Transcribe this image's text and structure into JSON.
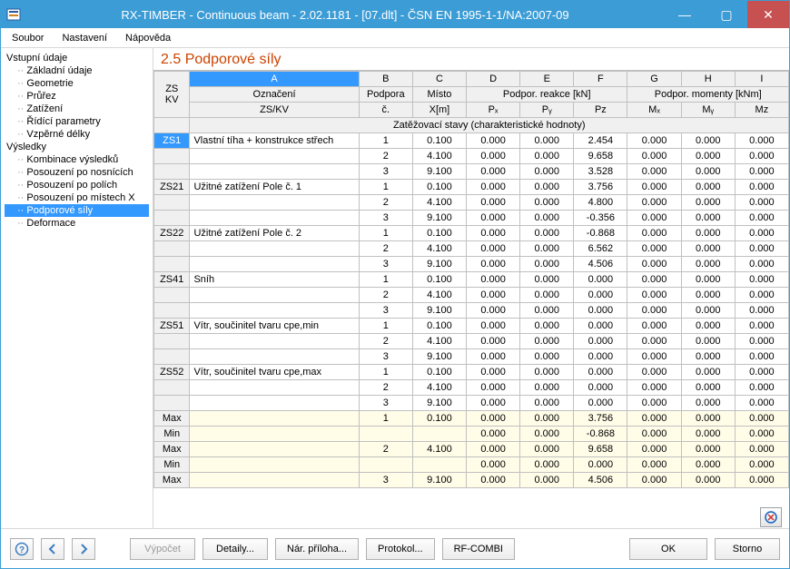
{
  "titlebar": {
    "title": "RX-TIMBER - Continuous beam - 2.02.1181 - [07.dlt] - ČSN EN 1995-1-1/NA:2007-09"
  },
  "menu": {
    "soubor": "Soubor",
    "nastaveni": "Nastavení",
    "napoveda": "Nápověda"
  },
  "nav": {
    "vstupni": "Vstupní údaje",
    "zakladni": "Základní údaje",
    "geometrie": "Geometrie",
    "prurez": "Průřez",
    "zatizeni": "Zatížení",
    "ridici": "Řídící parametry",
    "vzperne": "Vzpěrné délky",
    "vysledky": "Výsledky",
    "kombinace": "Kombinace výsledků",
    "nosniky": "Posouzení po nosnících",
    "polich": "Posouzení po polích",
    "mistech": "Posouzení po místech X",
    "podporove": "Podporové síly",
    "deformace": "Deformace"
  },
  "main": {
    "title": "2.5 Podporové síly"
  },
  "header": {
    "cols": {
      "A": "A",
      "B": "B",
      "C": "C",
      "D": "D",
      "E": "E",
      "F": "F",
      "G": "G",
      "H": "H",
      "I": "I"
    },
    "zs": "ZS",
    "kv": "KV",
    "oznaceni": "Označení",
    "zskv": "ZS/KV",
    "podpora": "Podpora",
    "c": "č.",
    "misto": "Místo",
    "xm": "X[m]",
    "reakce": "Podpor. reakce [kN]",
    "px": "Pₓ",
    "py": "Pᵧ",
    "pz": "Pz",
    "momenty": "Podpor. momenty [kNm]",
    "mx": "Mₓ",
    "my": "Mᵧ",
    "mz": "Mz"
  },
  "group1": "Zatěžovací stavy (charakteristické hodnoty)",
  "rows": [
    {
      "zs": "ZS1",
      "zs_sel": true,
      "label": "Vlastní tíha + konstrukce střech",
      "b": "1",
      "c": "0.100",
      "d": "0.000",
      "e": "0.000",
      "f": "2.454",
      "g": "0.000",
      "h": "0.000",
      "i": "0.000"
    },
    {
      "zs": "",
      "label": "",
      "b": "2",
      "c": "4.100",
      "d": "0.000",
      "e": "0.000",
      "f": "9.658",
      "g": "0.000",
      "h": "0.000",
      "i": "0.000"
    },
    {
      "zs": "",
      "label": "",
      "b": "3",
      "c": "9.100",
      "d": "0.000",
      "e": "0.000",
      "f": "3.528",
      "g": "0.000",
      "h": "0.000",
      "i": "0.000"
    },
    {
      "zs": "ZS21",
      "label": "Užitné zatížení Pole č. 1",
      "b": "1",
      "c": "0.100",
      "d": "0.000",
      "e": "0.000",
      "f": "3.756",
      "g": "0.000",
      "h": "0.000",
      "i": "0.000"
    },
    {
      "zs": "",
      "label": "",
      "b": "2",
      "c": "4.100",
      "d": "0.000",
      "e": "0.000",
      "f": "4.800",
      "g": "0.000",
      "h": "0.000",
      "i": "0.000"
    },
    {
      "zs": "",
      "label": "",
      "b": "3",
      "c": "9.100",
      "d": "0.000",
      "e": "0.000",
      "f": "-0.356",
      "g": "0.000",
      "h": "0.000",
      "i": "0.000"
    },
    {
      "zs": "ZS22",
      "label": "Užitné zatížení Pole č. 2",
      "b": "1",
      "c": "0.100",
      "d": "0.000",
      "e": "0.000",
      "f": "-0.868",
      "g": "0.000",
      "h": "0.000",
      "i": "0.000"
    },
    {
      "zs": "",
      "label": "",
      "b": "2",
      "c": "4.100",
      "d": "0.000",
      "e": "0.000",
      "f": "6.562",
      "g": "0.000",
      "h": "0.000",
      "i": "0.000"
    },
    {
      "zs": "",
      "label": "",
      "b": "3",
      "c": "9.100",
      "d": "0.000",
      "e": "0.000",
      "f": "4.506",
      "g": "0.000",
      "h": "0.000",
      "i": "0.000"
    },
    {
      "zs": "ZS41",
      "label": "Sníh",
      "b": "1",
      "c": "0.100",
      "d": "0.000",
      "e": "0.000",
      "f": "0.000",
      "g": "0.000",
      "h": "0.000",
      "i": "0.000"
    },
    {
      "zs": "",
      "label": "",
      "b": "2",
      "c": "4.100",
      "d": "0.000",
      "e": "0.000",
      "f": "0.000",
      "g": "0.000",
      "h": "0.000",
      "i": "0.000"
    },
    {
      "zs": "",
      "label": "",
      "b": "3",
      "c": "9.100",
      "d": "0.000",
      "e": "0.000",
      "f": "0.000",
      "g": "0.000",
      "h": "0.000",
      "i": "0.000"
    },
    {
      "zs": "ZS51",
      "label": "Vítr, součinitel tvaru cpe,min",
      "b": "1",
      "c": "0.100",
      "d": "0.000",
      "e": "0.000",
      "f": "0.000",
      "g": "0.000",
      "h": "0.000",
      "i": "0.000"
    },
    {
      "zs": "",
      "label": "",
      "b": "2",
      "c": "4.100",
      "d": "0.000",
      "e": "0.000",
      "f": "0.000",
      "g": "0.000",
      "h": "0.000",
      "i": "0.000"
    },
    {
      "zs": "",
      "label": "",
      "b": "3",
      "c": "9.100",
      "d": "0.000",
      "e": "0.000",
      "f": "0.000",
      "g": "0.000",
      "h": "0.000",
      "i": "0.000"
    },
    {
      "zs": "ZS52",
      "label": "Vítr, součinitel tvaru cpe,max",
      "b": "1",
      "c": "0.100",
      "d": "0.000",
      "e": "0.000",
      "f": "0.000",
      "g": "0.000",
      "h": "0.000",
      "i": "0.000"
    },
    {
      "zs": "",
      "label": "",
      "b": "2",
      "c": "4.100",
      "d": "0.000",
      "e": "0.000",
      "f": "0.000",
      "g": "0.000",
      "h": "0.000",
      "i": "0.000"
    },
    {
      "zs": "",
      "label": "",
      "b": "3",
      "c": "9.100",
      "d": "0.000",
      "e": "0.000",
      "f": "0.000",
      "g": "0.000",
      "h": "0.000",
      "i": "0.000"
    },
    {
      "zs": "Max",
      "cream": true,
      "label": "",
      "b": "1",
      "c": "0.100",
      "d": "0.000",
      "e": "0.000",
      "f": "3.756",
      "g": "0.000",
      "h": "0.000",
      "i": "0.000"
    },
    {
      "zs": "Min",
      "cream": true,
      "label": "",
      "b": "",
      "c": "",
      "d": "0.000",
      "e": "0.000",
      "f": "-0.868",
      "g": "0.000",
      "h": "0.000",
      "i": "0.000"
    },
    {
      "zs": "Max",
      "cream": true,
      "label": "",
      "b": "2",
      "c": "4.100",
      "d": "0.000",
      "e": "0.000",
      "f": "9.658",
      "g": "0.000",
      "h": "0.000",
      "i": "0.000"
    },
    {
      "zs": "Min",
      "cream": true,
      "label": "",
      "b": "",
      "c": "",
      "d": "0.000",
      "e": "0.000",
      "f": "0.000",
      "g": "0.000",
      "h": "0.000",
      "i": "0.000"
    },
    {
      "zs": "Max",
      "cream": true,
      "label": "",
      "b": "3",
      "c": "9.100",
      "d": "0.000",
      "e": "0.000",
      "f": "4.506",
      "g": "0.000",
      "h": "0.000",
      "i": "0.000"
    }
  ],
  "buttons": {
    "vypocet": "Výpočet",
    "detaily": "Detaily...",
    "priloha": "Nár. příloha...",
    "protokol": "Protokol...",
    "rfcombi": "RF-COMBI",
    "ok": "OK",
    "storno": "Storno"
  }
}
